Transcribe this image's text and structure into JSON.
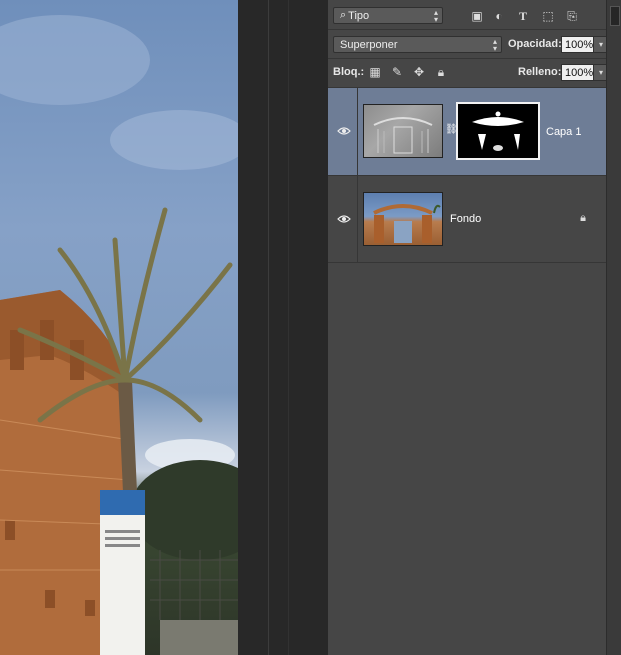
{
  "toolbar": {
    "filter_label": "Tipo",
    "blend_mode": "Superponer",
    "opacity_label": "Opacidad:",
    "opacity_value": "100%",
    "lock_label": "Bloq.:",
    "fill_label": "Relleno:",
    "fill_value": "100%"
  },
  "layers": [
    {
      "name": "Capa 1",
      "selected": true,
      "has_mask": true
    },
    {
      "name": "Fondo",
      "selected": false,
      "locked": true
    }
  ]
}
